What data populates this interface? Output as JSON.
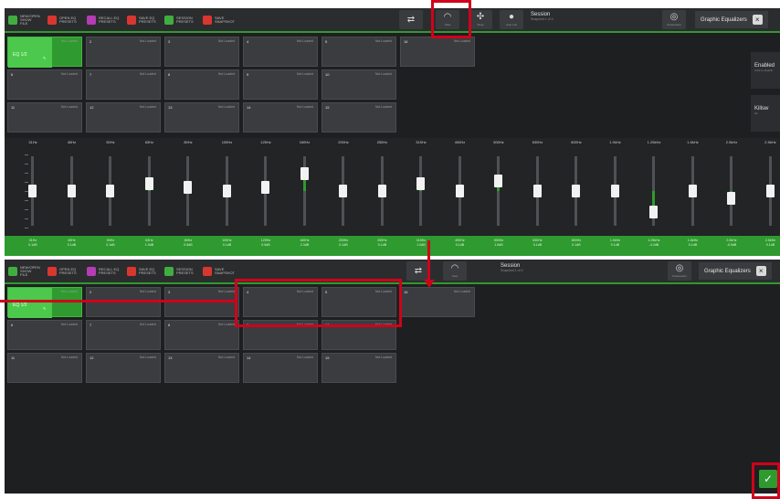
{
  "toolbar": {
    "items": [
      {
        "icon": "green-square-icon",
        "color": "#3fae3f",
        "label": "NEW/OPEN\nSHOW\nFILE"
      },
      {
        "icon": "red-square-icon",
        "color": "#d8372f",
        "label": "OPEN EQ\nPRESETS"
      },
      {
        "icon": "magenta-square-icon",
        "color": "#b43cb4",
        "label": "RECALL EQ\nPRESETS"
      },
      {
        "icon": "red-square-icon",
        "color": "#d8372f",
        "label": "SAVE EQ\nPRESETS"
      },
      {
        "icon": "green-square-icon",
        "color": "#3fae3f",
        "label": "SESSION\nPRESETS"
      },
      {
        "icon": "red-square-icon",
        "color": "#d8372f",
        "label": "SAVE\nSNAPSHOT"
      }
    ],
    "buttons": [
      {
        "name": "link-button",
        "glyph": "⇄",
        "caption": ""
      },
      {
        "name": "view-button",
        "glyph": "◠",
        "caption": "View"
      },
      {
        "name": "snap-button",
        "glyph": "✣",
        "caption": "Snap"
      },
      {
        "name": "user-button",
        "glyph": "●",
        "caption": "User List"
      }
    ],
    "session_title": "Session",
    "session_sub": "Snapshot 1 of 4",
    "geq_title": "Graphic Equalizers",
    "settings_glyph": "◎",
    "settings_caption": "Parameters"
  },
  "tiles_top": [
    {
      "num": "",
      "tag": "Not Loaded",
      "active": true,
      "label": "EQ 1/2"
    },
    {
      "num": "2",
      "tag": "Not Loaded"
    },
    {
      "num": "3",
      "tag": "Not Loaded"
    },
    {
      "num": "4",
      "tag": "Not Loaded"
    },
    {
      "num": "5",
      "tag": "Not Loaded"
    },
    {
      "num": "6",
      "tag": "Not Loaded"
    },
    {
      "num": "7",
      "tag": "Not Loaded"
    },
    {
      "num": "8",
      "tag": "Not Loaded"
    },
    {
      "num": "9",
      "tag": "Not Loaded"
    },
    {
      "num": "10",
      "tag": "Not Loaded"
    },
    {
      "num": "11",
      "tag": "Not Loaded"
    },
    {
      "num": "12",
      "tag": "Not Loaded"
    },
    {
      "num": "13",
      "tag": "Not Loaded"
    },
    {
      "num": "14",
      "tag": "Not Loaded"
    },
    {
      "num": "15",
      "tag": "Not Loaded"
    },
    {
      "num": "16",
      "tag": "Not Loaded"
    }
  ],
  "side_panel": {
    "enabled_title": "Enabled",
    "enabled_sub": "Click to disable",
    "second_title": "Killsw",
    "second_sub": "On"
  },
  "faders": [
    {
      "freq": "31Hz",
      "level": 0.5,
      "value": "0.1dB"
    },
    {
      "freq": "40Hz",
      "level": 0.5,
      "value": "0.1dB"
    },
    {
      "freq": "50Hz",
      "level": 0.5,
      "value": "0.1dB"
    },
    {
      "freq": "63Hz",
      "level": 0.6,
      "value": "1.0dB"
    },
    {
      "freq": "80Hz",
      "level": 0.55,
      "value": "0.5dB"
    },
    {
      "freq": "100Hz",
      "level": 0.5,
      "value": "0.1dB"
    },
    {
      "freq": "125Hz",
      "level": 0.55,
      "value": "0.5dB"
    },
    {
      "freq": "160Hz",
      "level": 0.75,
      "value": "2.3dB"
    },
    {
      "freq": "200Hz",
      "level": 0.5,
      "value": "0.1dB"
    },
    {
      "freq": "250Hz",
      "level": 0.5,
      "value": "0.1dB"
    },
    {
      "freq": "315Hz",
      "level": 0.6,
      "value": "1.0dB"
    },
    {
      "freq": "400Hz",
      "level": 0.5,
      "value": "0.1dB"
    },
    {
      "freq": "500Hz",
      "level": 0.65,
      "value": "1.5dB"
    },
    {
      "freq": "630Hz",
      "level": 0.5,
      "value": "0.1dB"
    },
    {
      "freq": "800Hz",
      "level": 0.5,
      "value": "0.1dB"
    },
    {
      "freq": "1.0kHz",
      "level": 0.5,
      "value": "0.1dB"
    },
    {
      "freq": "1.25kHz",
      "level": 0.2,
      "value": "-4.2dB"
    },
    {
      "freq": "1.6kHz",
      "level": 0.5,
      "value": "0.1dB"
    },
    {
      "freq": "2.0kHz",
      "level": 0.4,
      "value": "-0.9dB"
    },
    {
      "freq": "2.5kHz",
      "level": 0.5,
      "value": "0.1dB"
    }
  ],
  "tiles_bottom": [
    {
      "num": "",
      "tag": "Not Loaded",
      "active": true,
      "label": "EQ 1/2"
    },
    {
      "num": "2",
      "tag": "Not Loaded"
    },
    {
      "num": "3",
      "tag": "Not Loaded"
    },
    {
      "num": "4",
      "tag": "Not Loaded"
    },
    {
      "num": "5",
      "tag": "Not Loaded"
    },
    {
      "num": "6",
      "tag": "Not Loaded"
    },
    {
      "num": "7",
      "tag": "Not Loaded"
    },
    {
      "num": "8",
      "tag": "Not Loaded"
    },
    {
      "num": "9",
      "tag": "Not Loaded"
    },
    {
      "num": "10",
      "tag": "Not Loaded"
    },
    {
      "num": "11",
      "tag": "Not Loaded"
    },
    {
      "num": "12",
      "tag": "Not Loaded"
    },
    {
      "num": "13",
      "tag": "Not Loaded"
    },
    {
      "num": "14",
      "tag": "Not Loaded"
    },
    {
      "num": "15",
      "tag": "Not Loaded"
    },
    {
      "num": "16",
      "tag": "Not Loaded"
    }
  ],
  "confirm_glyph": "✓",
  "colors": {
    "accent": "#2f9a2f",
    "highlight": "#d0021b",
    "background": "#1e1f21"
  }
}
